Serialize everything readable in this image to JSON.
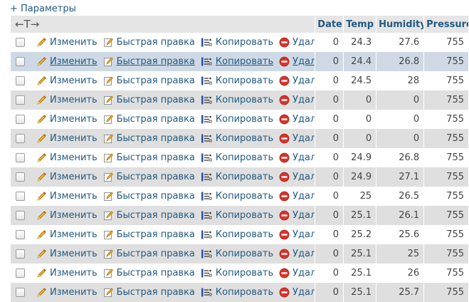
{
  "options_link": "+ Параметры",
  "header": {
    "arrows_label": "←T→",
    "columns": [
      "Date",
      "Temp",
      "Humidity",
      "Pressure"
    ]
  },
  "actions": {
    "edit": "Изменить",
    "quick_edit": "Быстрая правка",
    "copy": "Копировать",
    "delete": "Удалить"
  },
  "rows": [
    {
      "date": "0",
      "temp": "24.3",
      "humidity": "27.6",
      "pressure": "755"
    },
    {
      "date": "0",
      "temp": "24.4",
      "humidity": "26.8",
      "pressure": "755"
    },
    {
      "date": "0",
      "temp": "24.5",
      "humidity": "28",
      "pressure": "755"
    },
    {
      "date": "0",
      "temp": "0",
      "humidity": "0",
      "pressure": "755"
    },
    {
      "date": "0",
      "temp": "0",
      "humidity": "0",
      "pressure": "755"
    },
    {
      "date": "0",
      "temp": "0",
      "humidity": "0",
      "pressure": "755"
    },
    {
      "date": "0",
      "temp": "24.9",
      "humidity": "26.8",
      "pressure": "755"
    },
    {
      "date": "0",
      "temp": "24.9",
      "humidity": "27.1",
      "pressure": "755"
    },
    {
      "date": "0",
      "temp": "25",
      "humidity": "26.5",
      "pressure": "755"
    },
    {
      "date": "0",
      "temp": "25.1",
      "humidity": "26.1",
      "pressure": "755"
    },
    {
      "date": "0",
      "temp": "25.2",
      "humidity": "25.6",
      "pressure": "755"
    },
    {
      "date": "0",
      "temp": "25.1",
      "humidity": "25",
      "pressure": "755"
    },
    {
      "date": "0",
      "temp": "25.1",
      "humidity": "26",
      "pressure": "755"
    },
    {
      "date": "0",
      "temp": "25.1",
      "humidity": "25.7",
      "pressure": "755"
    }
  ],
  "hovered_row": 1,
  "colors": {
    "link": "#235a81",
    "row_even": "#dfdfdf",
    "row_hover": "#cfd9e6",
    "header_bg": "#e5e5e5",
    "delete_red": "#d9332b"
  },
  "icons": [
    "pencil-icon",
    "quick-edit-icon",
    "copy-icon",
    "delete-icon",
    "checkbox"
  ]
}
